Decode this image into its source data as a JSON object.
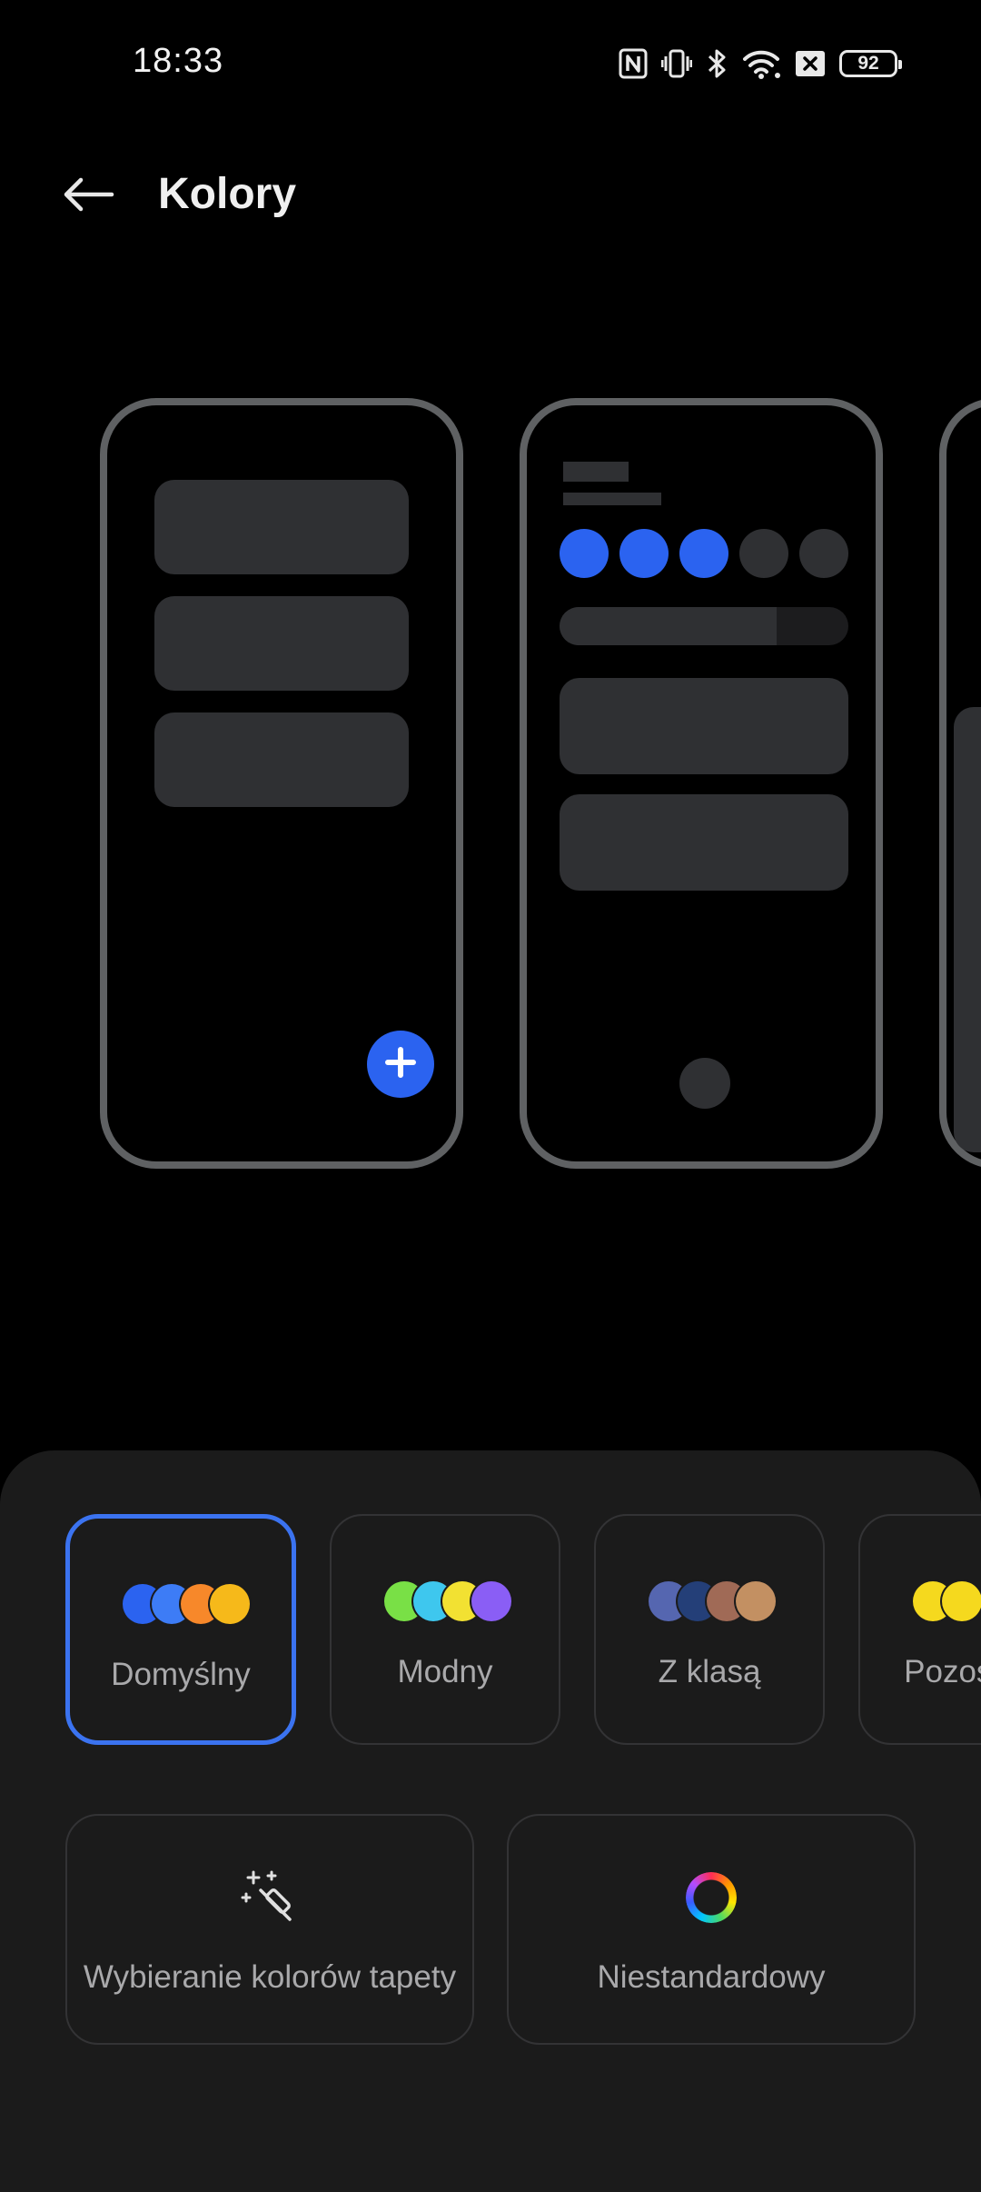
{
  "status_bar": {
    "time": "18:33",
    "battery_level": "92",
    "icons": [
      "nfc-icon",
      "vibrate-icon",
      "bluetooth-icon",
      "wifi-icon",
      "no-sim-icon",
      "battery-icon"
    ]
  },
  "header": {
    "back_icon": "arrow-left-icon",
    "title": "Kolory"
  },
  "previews": {
    "accent_color": "#2b63f0",
    "card_color": "#2f3033",
    "frame_color": "#5f6163",
    "slider_level": 0.75,
    "fab_icon": "plus-icon"
  },
  "palettes": [
    {
      "label": "Domyślny",
      "selected": true,
      "colors": [
        "#2b63f0",
        "#3d7cf6",
        "#f7882a",
        "#f6b91a"
      ]
    },
    {
      "label": "Modny",
      "selected": false,
      "colors": [
        "#79e046",
        "#3ec7ee",
        "#f2e132",
        "#8a5ef5"
      ]
    },
    {
      "label": "Z klasą",
      "selected": false,
      "colors": [
        "#5566b0",
        "#243f78",
        "#a06a56",
        "#c39062"
      ]
    },
    {
      "label": "Pozostałe",
      "selected": false,
      "colors": [
        "#f5d91e",
        "#f5d91e"
      ]
    }
  ],
  "options": [
    {
      "label": "Wybieranie kolorów tapety",
      "icon": "magic-wand-icon"
    },
    {
      "label": "Niestandardowy",
      "icon": "color-ring-icon"
    }
  ]
}
